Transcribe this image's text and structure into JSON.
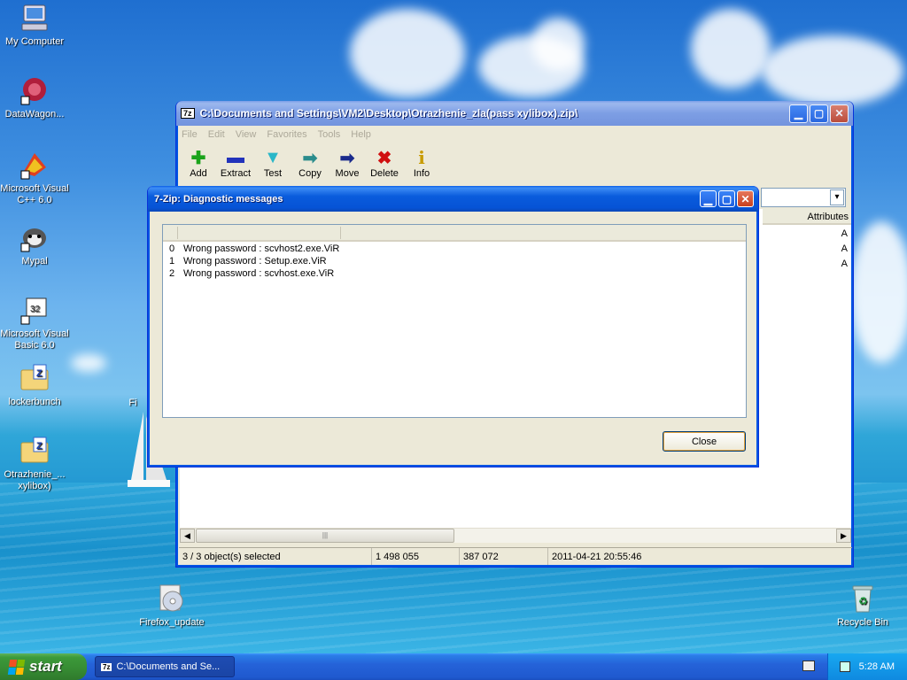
{
  "desktop": {
    "icons": [
      {
        "label": "My Computer",
        "icon": "my-computer-icon"
      },
      {
        "label": "DataWagon...",
        "icon": "datawagon-icon"
      },
      {
        "label": "Microsoft Visual C++ 6.0",
        "icon": "visual-cpp-icon"
      },
      {
        "label": "Mypal",
        "icon": "mypal-icon"
      },
      {
        "label": "Microsoft Visual Basic 6.0",
        "icon": "visual-basic-icon"
      },
      {
        "label": "lockerbunch",
        "icon": "zip-folder-icon"
      },
      {
        "label": "Otrazhenie_... xylibox)",
        "icon": "zip-folder-icon"
      },
      {
        "label": "Firefox_update",
        "icon": "cd-icon"
      },
      {
        "label": "Recycle Bin",
        "icon": "recycle-bin-icon"
      }
    ],
    "partial_label": "Fi"
  },
  "main_window": {
    "title": "C:\\Documents and Settings\\VM2\\Desktop\\Otrazhenie_zla(pass xylibox).zip\\",
    "app_icon": "7z",
    "menu": [
      "File",
      "Edit",
      "View",
      "Favorites",
      "Tools",
      "Help"
    ],
    "toolbar": [
      {
        "label": "Add",
        "icon": "add-icon",
        "glyph": "✚",
        "color": "#1aa31a"
      },
      {
        "label": "Extract",
        "icon": "extract-icon",
        "glyph": "▬",
        "color": "#2233bb"
      },
      {
        "label": "Test",
        "icon": "test-icon",
        "glyph": "▼",
        "color": "#2ab7c8"
      },
      {
        "label": "Copy",
        "icon": "copy-icon",
        "glyph": "➡",
        "color": "#2a8c8c"
      },
      {
        "label": "Move",
        "icon": "move-icon",
        "glyph": "➡",
        "color": "#1a2a8c"
      },
      {
        "label": "Delete",
        "icon": "delete-icon",
        "glyph": "✖",
        "color": "#d01010"
      },
      {
        "label": "Info",
        "icon": "info-icon",
        "glyph": "i",
        "color": "#c89b00"
      }
    ],
    "column_header": "Attributes",
    "attribute_values": [
      "A",
      "A",
      "A"
    ],
    "scrollbar_grip": "|||",
    "status": {
      "selected": "3 / 3 object(s) selected",
      "size": "1 498 055",
      "packed": "387 072",
      "modified": "2011-04-21 20:55:46"
    }
  },
  "dialog": {
    "title": "7-Zip: Diagnostic messages",
    "messages": [
      {
        "index": "0",
        "text": "Wrong password : scvhost2.exe.ViR"
      },
      {
        "index": "1",
        "text": "Wrong password : Setup.exe.ViR"
      },
      {
        "index": "2",
        "text": "Wrong password : scvhost.exe.ViR"
      }
    ],
    "close_label": "Close"
  },
  "taskbar": {
    "start_label": "start",
    "task_label": "C:\\Documents and Se...",
    "clock": "5:28 AM"
  }
}
